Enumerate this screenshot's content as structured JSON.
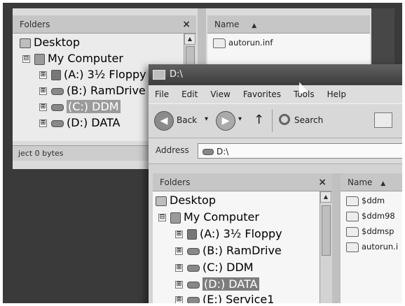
{
  "background_window": {
    "folders_pane": {
      "title": "Folders",
      "close": "×",
      "items": [
        {
          "label": "Desktop"
        },
        {
          "label": "My Computer",
          "expander": "⊟"
        },
        {
          "label": "(A:) 3½ Floppy",
          "expander": "⊞"
        },
        {
          "label": "(B:) RamDrive",
          "expander": "⊞"
        },
        {
          "label": "(C:) DDM",
          "expander": "⊞"
        },
        {
          "label": "(D:) DATA",
          "expander": "⊞"
        }
      ]
    },
    "files_pane": {
      "column_header": "Name",
      "sort_indicator": "▲",
      "items": [
        {
          "label": "autorun.inf"
        }
      ]
    },
    "status_text": "ject 0 bytes"
  },
  "foreground_window": {
    "title": "D:\\",
    "menu": [
      "File",
      "Edit",
      "View",
      "Favorites",
      "Tools",
      "Help"
    ],
    "toolbar": {
      "back_label": "Back",
      "back_icon": "◀",
      "forward_icon": "▶",
      "dropdown_icon": "▾",
      "up_icon": "↑",
      "search_label": "Search"
    },
    "address": {
      "label": "Address",
      "value": "D:\\"
    },
    "folders_pane": {
      "title": "Folders",
      "close": "×",
      "items": [
        {
          "label": "Desktop"
        },
        {
          "label": "My Computer",
          "expander": "⊟"
        },
        {
          "label": "(A:) 3½ Floppy",
          "expander": "⊞"
        },
        {
          "label": "(B:) RamDrive",
          "expander": "⊞"
        },
        {
          "label": "(C:) DDM",
          "expander": "⊞"
        },
        {
          "label": "(D:) DATA",
          "expander": "⊞",
          "selected": true
        },
        {
          "label": "(E:) Service1",
          "expander": "⊞"
        }
      ]
    },
    "files_pane": {
      "column_header": "Name",
      "sort_indicator": "▲",
      "items": [
        {
          "label": "$ddm"
        },
        {
          "label": "$ddm98"
        },
        {
          "label": "$ddmsp"
        },
        {
          "label": "autorun.i"
        }
      ]
    }
  },
  "icons": {
    "desktop": "desktop-icon",
    "computer": "computer-icon",
    "floppy": "floppy-drive-icon",
    "drive": "hard-drive-icon",
    "folder": "folder-icon",
    "file": "file-icon",
    "search": "search-icon"
  }
}
